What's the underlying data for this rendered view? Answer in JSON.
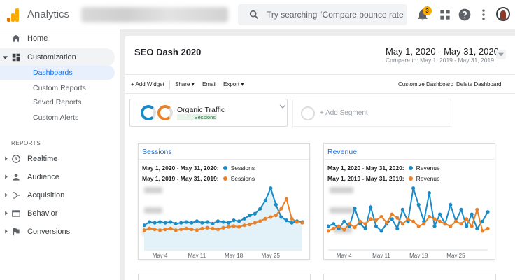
{
  "header": {
    "app_name": "Analytics",
    "search_placeholder": "Try searching “Compare bounce rate ...",
    "notification_count": "3"
  },
  "sidebar": {
    "home": "Home",
    "customization": "Customization",
    "sub_items": [
      "Dashboards",
      "Custom Reports",
      "Saved Reports",
      "Custom Alerts"
    ],
    "reports_label": "REPORTS",
    "reports": [
      "Realtime",
      "Audience",
      "Acquisition",
      "Behavior",
      "Conversions"
    ]
  },
  "dashboard": {
    "title": "SEO Dash 2020",
    "date_range": "May 1, 2020 - May 31, 2020",
    "compare_to": "Compare to: May 1, 2019 - May 31, 2019"
  },
  "toolbar": {
    "add_widget": "+ Add Widget",
    "share": "Share",
    "email": "Email",
    "export": "Export",
    "customize": "Customize Dashboard",
    "delete": "Delete Dashboard"
  },
  "segments": {
    "active_name": "Organic Traffic",
    "active_metric": "Sessions",
    "add_label": "+ Add Segment"
  },
  "colors": {
    "current": "#1a8bc6",
    "previous": "#e8822a",
    "link": "#1a73e8"
  },
  "widgets": [
    {
      "title": "Sessions",
      "current_label": "May 1, 2020 - May 31, 2020:",
      "previous_label": "May 1, 2019 - May 31, 2019:",
      "metric": "Sessions"
    },
    {
      "title": "Revenue",
      "current_label": "May 1, 2020 - May 31, 2020:",
      "previous_label": "May 1, 2019 - May 31, 2019:",
      "metric": "Revenue"
    }
  ],
  "chart_data": [
    {
      "type": "line",
      "x_ticks": [
        "May 4",
        "May 11",
        "May 18",
        "May 25"
      ],
      "series": [
        {
          "name": "May 1, 2020 - May 31, 2020",
          "values": [
            30,
            34,
            33,
            34,
            33,
            34,
            32,
            33,
            34,
            33,
            35,
            33,
            34,
            32,
            35,
            34,
            33,
            36,
            35,
            38,
            42,
            44,
            50,
            60,
            75,
            55,
            40,
            36,
            33,
            35,
            34
          ]
        },
        {
          "name": "May 1, 2019 - May 31, 2019",
          "values": [
            24,
            26,
            25,
            24,
            25,
            26,
            24,
            25,
            26,
            25,
            24,
            26,
            27,
            26,
            25,
            27,
            28,
            29,
            28,
            30,
            31,
            33,
            35,
            38,
            40,
            42,
            50,
            62,
            38,
            34,
            33
          ]
        }
      ]
    },
    {
      "type": "line",
      "x_ticks": [
        "May 4",
        "May 11",
        "May 18",
        "May 25"
      ],
      "series": [
        {
          "name": "May 1, 2020 - May 31, 2020",
          "values": [
            20,
            22,
            18,
            24,
            20,
            35,
            22,
            18,
            36,
            20,
            16,
            22,
            26,
            18,
            34,
            24,
            52,
            38,
            24,
            48,
            20,
            30,
            22,
            38,
            24,
            34,
            20,
            30,
            18,
            24,
            32
          ]
        },
        {
          "name": "May 1, 2019 - May 31, 2019",
          "values": [
            16,
            18,
            20,
            17,
            22,
            19,
            24,
            22,
            26,
            25,
            28,
            23,
            30,
            27,
            22,
            26,
            24,
            20,
            22,
            28,
            26,
            24,
            22,
            20,
            24,
            22,
            26,
            20,
            34,
            16,
            18
          ]
        }
      ]
    }
  ]
}
